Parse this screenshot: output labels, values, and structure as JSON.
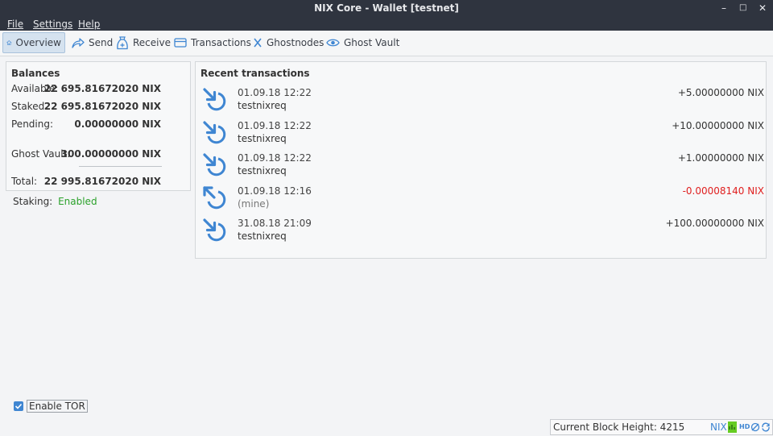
{
  "window": {
    "title": "NIX Core - Wallet [testnet]"
  },
  "menu": {
    "file": "File",
    "settings": "Settings",
    "help": "Help"
  },
  "tabs": {
    "overview": "Overview",
    "send": "Send",
    "receive": "Receive",
    "transactions": "Transactions",
    "ghostnodes": "Ghostnodes",
    "ghost_vault": "Ghost Vault"
  },
  "balances": {
    "heading": "Balances",
    "available_label": "Available:",
    "available_value": "22 695.81672020 NIX",
    "staked_label": "Staked",
    "staked_value": "22 695.81672020 NIX",
    "pending_label": "Pending:",
    "pending_value": "0.00000000 NIX",
    "ghost_vault_label": "Ghost Vault:",
    "ghost_vault_value": "300.00000000 NIX",
    "total_label": "Total:",
    "total_value": "22 995.81672020 NIX"
  },
  "staking": {
    "label": "Staking:",
    "value": "Enabled",
    "value_color": "#2aa12a"
  },
  "recent": {
    "heading": "Recent transactions",
    "items": [
      {
        "date": "01.09.18 12:22",
        "label": "testnixreq",
        "amount": "+5.00000000 NIX",
        "direction": "in"
      },
      {
        "date": "01.09.18 12:22",
        "label": "testnixreq",
        "amount": "+10.00000000 NIX",
        "direction": "in"
      },
      {
        "date": "01.09.18 12:22",
        "label": "testnixreq",
        "amount": "+1.00000000 NIX",
        "direction": "in"
      },
      {
        "date": "01.09.18 12:16",
        "label": "(mine)",
        "amount": "-0.00008140 NIX",
        "direction": "out"
      },
      {
        "date": "31.08.18 21:09",
        "label": "testnixreq",
        "amount": "+100.00000000 NIX",
        "direction": "in"
      }
    ]
  },
  "tor": {
    "label": "Enable TOR",
    "checked": true
  },
  "status": {
    "block_height": "Current Block Height: 4215",
    "unit": "NIX",
    "hd": "HD",
    "icons": [
      "network-icon",
      "hd-wallet-icon",
      "staking-icon",
      "sync-icon"
    ]
  },
  "colors": {
    "accent": "#3f86d2",
    "negative": "#e02020",
    "titlebar": "#2f343f"
  }
}
